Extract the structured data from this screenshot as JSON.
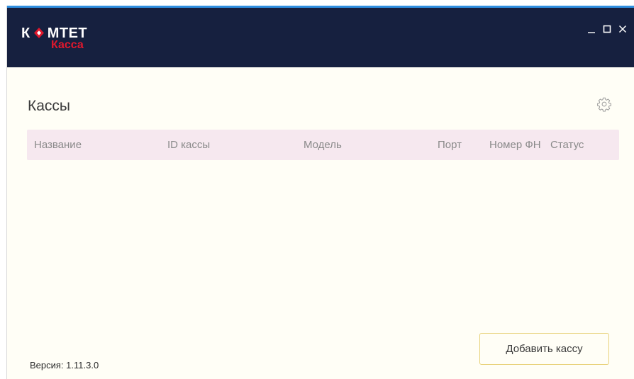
{
  "app": {
    "logo_main_prefix": "К",
    "logo_main_rest": "МТЕТ",
    "logo_sub": "Касса",
    "accent_color": "#e0182d",
    "titlebar_color": "#16203f"
  },
  "window_controls": {
    "minimize_icon": "minimize-icon",
    "maximize_icon": "maximize-icon",
    "close_icon": "close-icon"
  },
  "main": {
    "title": "Кассы",
    "settings_icon": "gear-icon"
  },
  "table": {
    "columns": [
      "Название",
      "ID кассы",
      "Модель",
      "Порт",
      "Номер ФН",
      "Статус"
    ],
    "rows": []
  },
  "footer": {
    "version_label": "Версия:",
    "version_value": "1.11.3.0",
    "add_button_label": "Добавить кассу"
  }
}
